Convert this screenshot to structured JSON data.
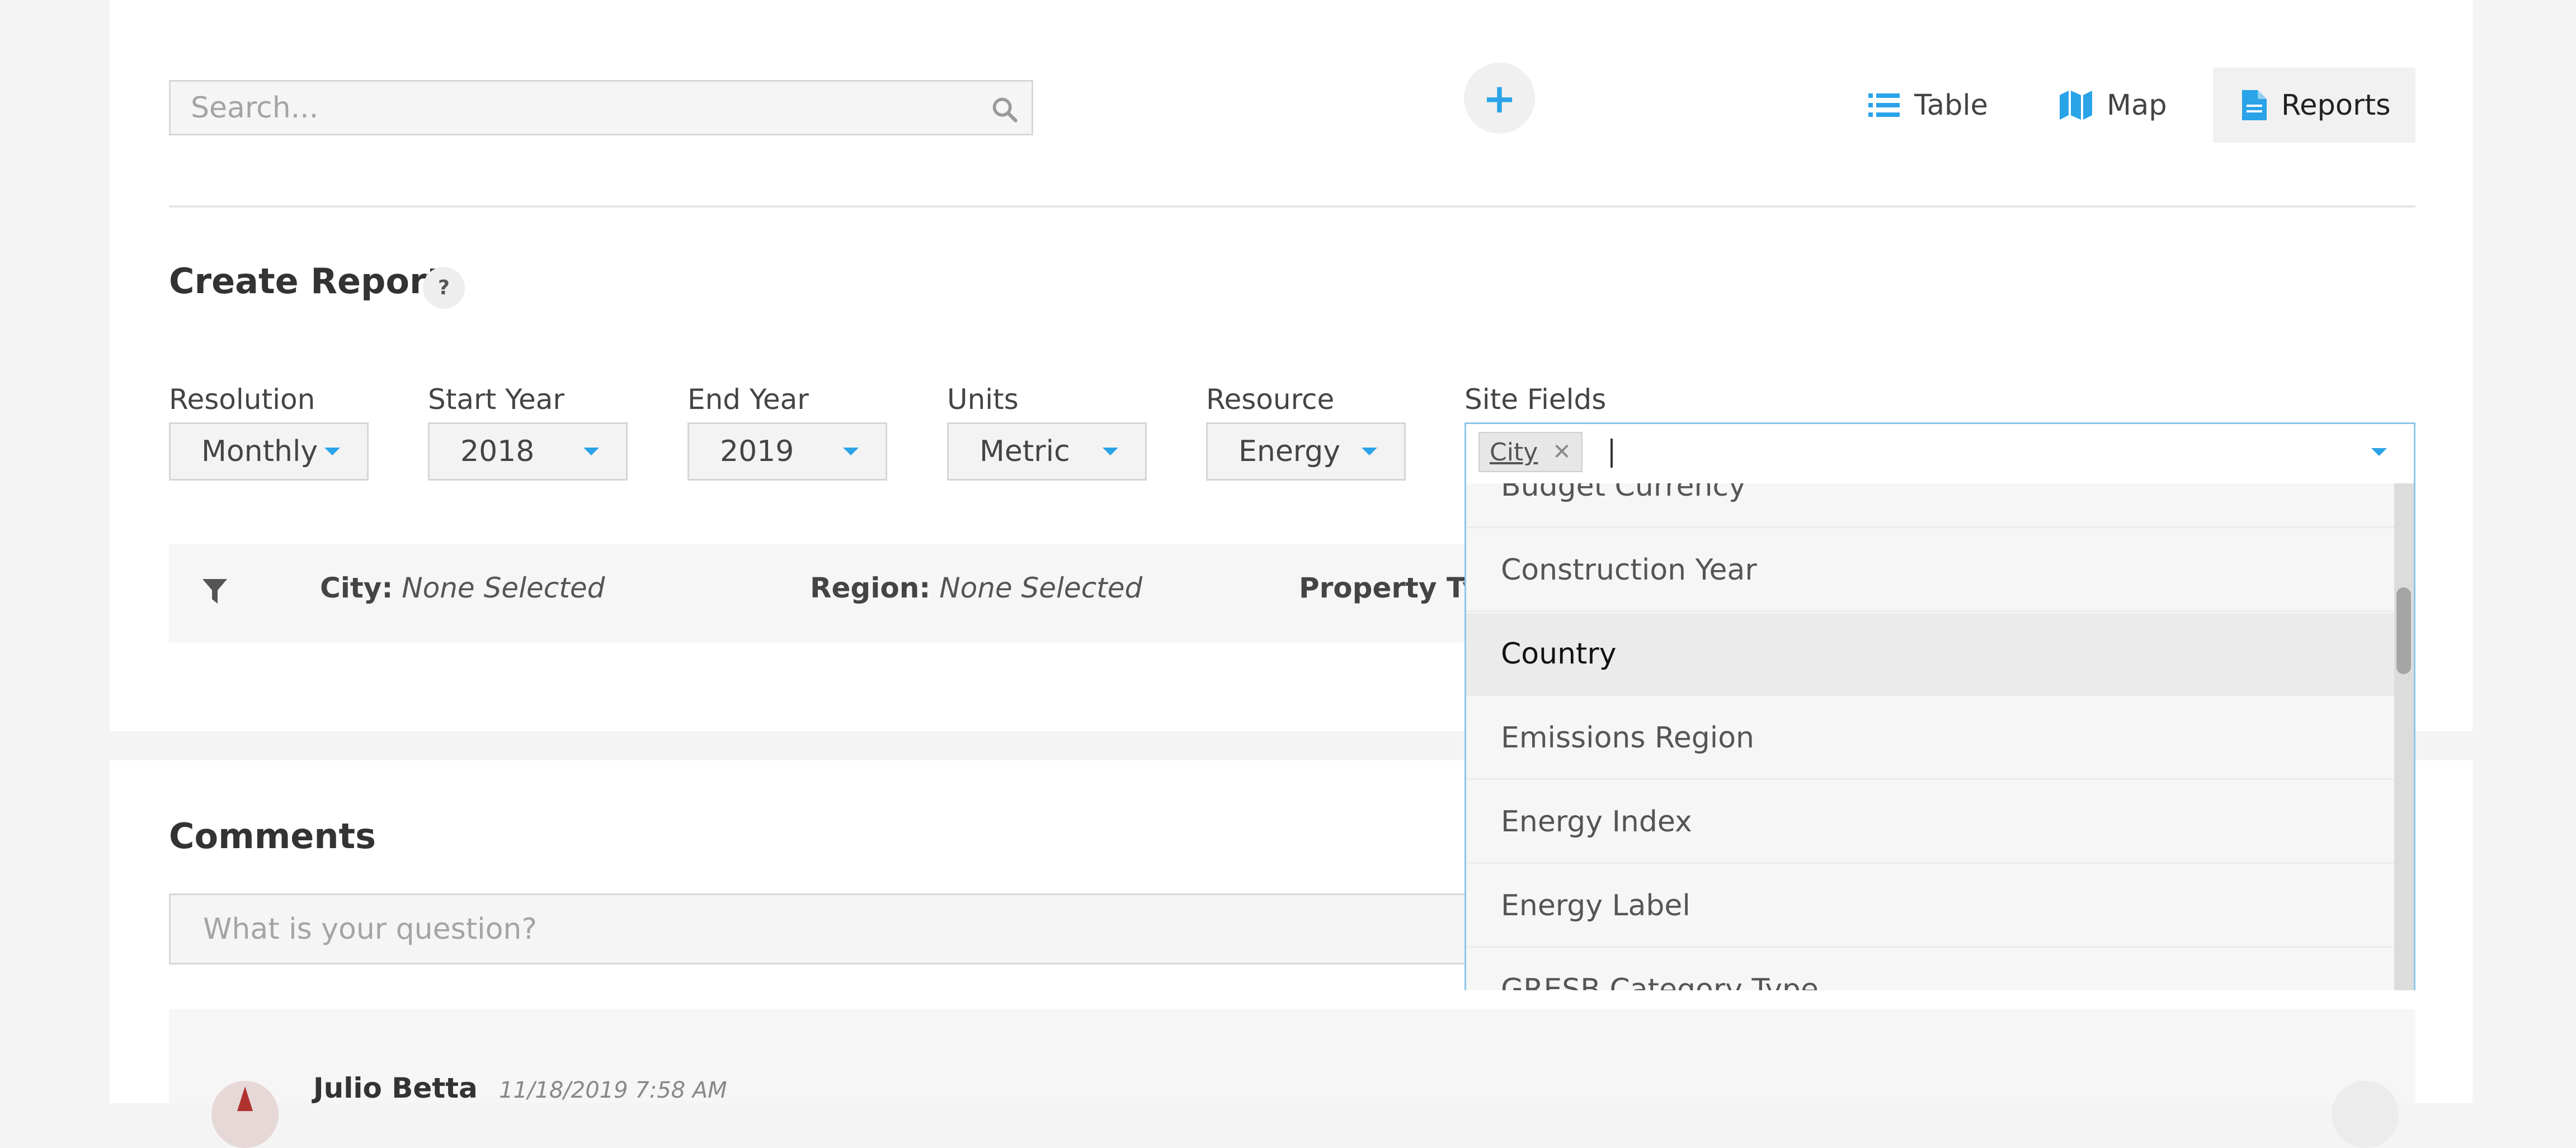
{
  "toolbar": {
    "search_placeholder": "Search...",
    "add_label": "+",
    "views": [
      {
        "label": "Table",
        "icon": "list-icon",
        "active": false
      },
      {
        "label": "Map",
        "icon": "map-icon",
        "active": false
      },
      {
        "label": "Reports",
        "icon": "document-icon",
        "active": true
      }
    ],
    "accent_color": "#2aa3e8"
  },
  "report": {
    "title": "Create Report",
    "help_label": "?",
    "fields": [
      {
        "label": "Resolution",
        "value": "Monthly"
      },
      {
        "label": "Start Year",
        "value": "2018"
      },
      {
        "label": "End Year",
        "value": "2019"
      },
      {
        "label": "Units",
        "value": "Metric"
      },
      {
        "label": "Resource",
        "value": "Energy"
      }
    ],
    "site_fields": {
      "label": "Site Fields",
      "selected_tags": [
        "City"
      ],
      "options": [
        "Budget Currency",
        "Construction Year",
        "Country",
        "Emissions Region",
        "Energy Index",
        "Energy Label",
        "GRESB Category Type"
      ],
      "highlighted_option": "Country"
    },
    "filters": [
      {
        "name": "City:",
        "value": "None Selected"
      },
      {
        "name": "Region:",
        "value": "None Selected"
      },
      {
        "name": "Property Typ",
        "value": ""
      }
    ]
  },
  "comments": {
    "title": "Comments",
    "placeholder": "What is your question?",
    "items": [
      {
        "author": "Julio Betta",
        "timestamp": "11/18/2019 7:58 AM"
      }
    ]
  }
}
